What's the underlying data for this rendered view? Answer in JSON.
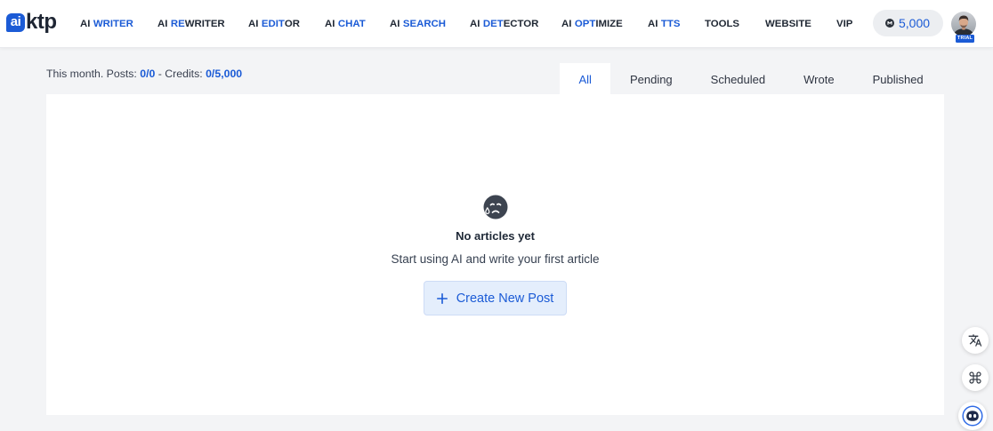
{
  "logo": {
    "mark": "ai",
    "wordmark": "ktp"
  },
  "nav": {
    "items": [
      {
        "prefix": "AI",
        "accent": "WRITER"
      },
      {
        "prefix": "AI",
        "accent": "RE",
        "rest": "WRITER"
      },
      {
        "prefix": "AI",
        "accent": "EDIT",
        "rest": "OR"
      },
      {
        "prefix": "AI",
        "accent": "CHAT"
      },
      {
        "prefix": "AI",
        "accent": "SEARCH"
      },
      {
        "prefix": "AI",
        "accent": "DET",
        "rest": "ECTOR"
      },
      {
        "prefix": "AI",
        "accent": "OPT",
        "rest": "IMIZE"
      },
      {
        "prefix": "AI",
        "accent": "TTS"
      },
      {
        "rest": "TOOLS"
      },
      {
        "rest": "WEBSITE"
      },
      {
        "rest": "VIP"
      }
    ]
  },
  "credits": {
    "icon": "coin-icon",
    "balance": "5,000"
  },
  "user": {
    "avatar": "user-avatar",
    "badge": "TRIAL"
  },
  "stats": {
    "posts_label": "This month. Posts:",
    "posts_value": "0/0",
    "credits_label": "- Credits:",
    "credits_value": "0/5,000"
  },
  "tabs": [
    {
      "label": "All",
      "active": true
    },
    {
      "label": "Pending",
      "active": false
    },
    {
      "label": "Scheduled",
      "active": false
    },
    {
      "label": "Wrote",
      "active": false
    },
    {
      "label": "Published",
      "active": false
    }
  ],
  "empty_state": {
    "icon": "sad-face-icon",
    "title": "No articles yet",
    "subtitle": "Start using AI and write your first article",
    "button_icon": "plus-icon",
    "button_label": "Create New Post"
  },
  "floating_actions": [
    {
      "icon": "translate-icon"
    },
    {
      "icon": "command-icon"
    },
    {
      "icon": "chatbot-icon"
    }
  ],
  "colors": {
    "accent": "#1b5bd6",
    "text": "#1f2937",
    "page_bg": "#f3f4f6",
    "surface": "#ffffff",
    "button_bg": "#e4eefc",
    "credits_pill_bg": "#eceef1",
    "trial_badge": "#1b5bd6"
  }
}
